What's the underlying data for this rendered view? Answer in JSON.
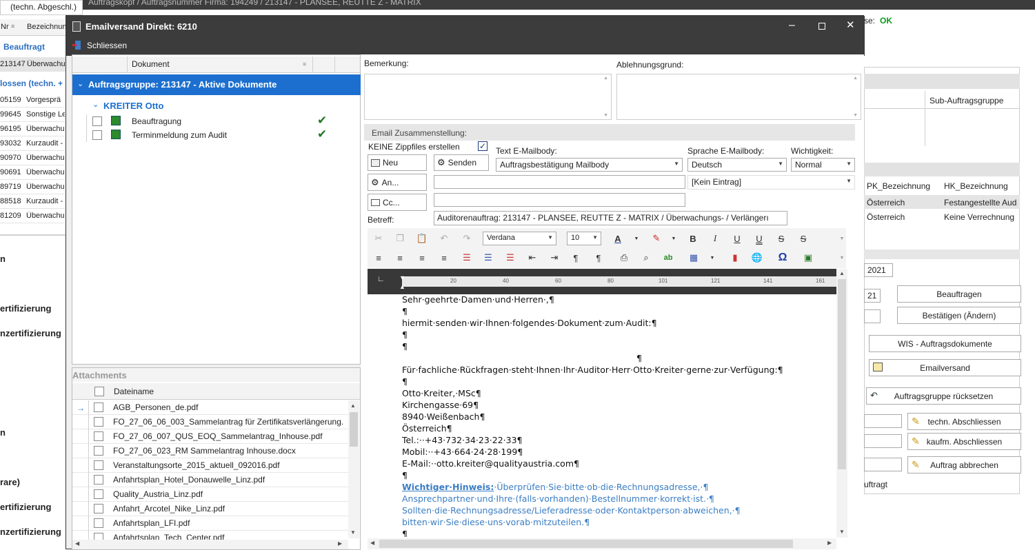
{
  "background": {
    "title_left": "(techn. Abgeschl.)",
    "title_bar": "Auftragskopf / Auftragsnummer  Firma: 194249 / 213147 - PLANSEE, REUTTE  Z - MATRIX",
    "status_label": "se:",
    "status_value": "OK",
    "col_nr": "Nr",
    "col_bezeichnung": "Bezeichnun",
    "group_beauftragt": "Beauftragt",
    "group_closed": "lossen (techn. +",
    "rows": [
      {
        "nr": "213147",
        "bez": "Überwachu"
      },
      {
        "nr": "05159",
        "bez": "Vorgesprä"
      },
      {
        "nr": "99645",
        "bez": "Sonstige Le"
      },
      {
        "nr": "96195",
        "bez": "Überwachu"
      },
      {
        "nr": "93032",
        "bez": "Kurzaudit -"
      },
      {
        "nr": "90970",
        "bez": "Überwachu"
      },
      {
        "nr": "90691",
        "bez": "Überwachu"
      },
      {
        "nr": "89719",
        "bez": "Überwachu"
      },
      {
        "nr": "88518",
        "bez": "Kurzaudit -"
      },
      {
        "nr": "81209",
        "bez": "Überwachu"
      }
    ],
    "left_labels": [
      "n",
      "ertifizierung",
      "nzertifizierung",
      "n",
      "rare)",
      "ertifizierung",
      "nzertifizierung"
    ],
    "right_col_sub": "Sub-Auftragsgruppe",
    "right_col_pk": "PK_Bezeichnung",
    "right_col_hk": "HK_Bezeichnung",
    "right_rows": [
      {
        "pk": "Österreich",
        "hk": "Festangestellte Aud"
      },
      {
        "pk": "Österreich",
        "hk": "Keine Verrechnung"
      }
    ],
    "year1": "2021",
    "year2": "21",
    "btn_beauftragen": "Beauftragen",
    "btn_bestaetigen": "Bestätigen (Ändern)",
    "btn_wis": "WIS - Auftragsdokumente",
    "btn_emailversand": "Emailversand",
    "btn_ruecksetzen": "Auftragsgruppe rücksetzen",
    "btn_techn": "techn. Abschliessen",
    "btn_kaufm": "kaufm. Abschliessen",
    "btn_abbrechen": "Auftrag abbrechen",
    "footer_status": "uftragt"
  },
  "dialog": {
    "title": "Emailversand Direkt: 6210",
    "close_label": "Schliessen",
    "doc_column": "Dokument",
    "group_row": "Auftragsgruppe: 213147 - Aktive Dokumente",
    "person": "KREITER Otto",
    "docs": [
      "Beauftragung",
      "Terminmeldung zum Audit"
    ],
    "attachments_title": "Attachments",
    "att_column": "Dateiname",
    "attachments": [
      "AGB_Personen_de.pdf",
      "FO_27_06_06_003_Sammelantrag für Zertifikatsverlängerung.",
      "FO_27_06_007_QUS_EOQ_Sammelantrag_Inhouse.pdf",
      "FO_27_06_023_RM Sammelantrag Inhouse.docx",
      "Veranstaltungsorte_2015_aktuell_092016.pdf",
      "Anfahrtsplan_Hotel_Donauwelle_Linz.pdf",
      "Quality_Austria_Linz.pdf",
      "Anfahrt_Arcotel_Nike_Linz.pdf",
      "Anfahrtsplan_LFI.pdf",
      "Anfahrtsplan_Tech_Center.pdf"
    ],
    "bemerkung_label": "Bemerkung:",
    "ablehnung_label": "Ablehnungsgrund:",
    "email_section": "Email Zusammenstellung:",
    "zip_label": "KEINE Zippfiles erstellen",
    "text_body_label": "Text E-Mailbody:",
    "sprache_label": "Sprache E-Mailbody:",
    "wichtigkeit_label": "Wichtigkeit:",
    "btn_neu": "Neu",
    "btn_senden": "Senden",
    "btn_an": "An...",
    "btn_cc": "Cc...",
    "body_select": "Auftragsbestätigung Mailbody",
    "sprache_select": "Deutsch",
    "wichtigkeit_select": "Normal",
    "an_value": "",
    "kein_eintrag": "[Kein Eintrag]",
    "cc_value": "",
    "betreff_label": "Betreff:",
    "betreff_value": "Auditorenauftrag: 213147 - PLANSEE, REUTTE   Z  - MATRIX / Überwachungs- / Verlängerı",
    "font_name": "Verdana",
    "font_size": "10",
    "ruler_marks": [
      "20",
      "40",
      "60",
      "80",
      "101",
      "121",
      "141",
      "161"
    ],
    "editor_lines": [
      "Sehr·geehrte·Damen·und·Herren·,¶",
      "¶",
      "hiermit·senden·wir·Ihnen·folgendes·Dokument·zum·Audit:¶",
      "¶",
      "¶",
      "¶",
      "Für·fachliche·Rückfragen·steht·Ihnen·Ihr·Auditor·Herr·Otto·Kreiter·gerne·zur·Verfügung:¶",
      "¶",
      "Otto·Kreiter,·MSc¶",
      "Kirchengasse·69¶",
      "8940·Weißenbach¶",
      "Österreich¶",
      "Tel.:··+43·732·34·23·22·33¶",
      "Mobil:··+43·664·24·28·199¶",
      "E-Mail:··otto.kreiter@qualityaustria.com¶",
      "¶"
    ],
    "hint_bold": "Wichtiger·Hinweis:",
    "hint_lines": [
      "·Überprüfen·Sie·bitte·ob·die·Rechnungsadresse,·¶",
      "Ansprechpartner·und·Ihre·(falls·vorhanden)·Bestellnummer·korrekt·ist.·¶",
      "Sollten·die·Rechnungsadresse/Lieferadresse·oder·Kontaktperson·abweichen,·¶",
      "bitten·wir·Sie·diese·uns·vorab·mitzuteilen.¶",
      "¶"
    ],
    "colors": {
      "titlebar": "#3c3c3c",
      "selection": "#1c6fcf",
      "link": "#3a7dc4",
      "ok": "#0a9a1a"
    }
  }
}
